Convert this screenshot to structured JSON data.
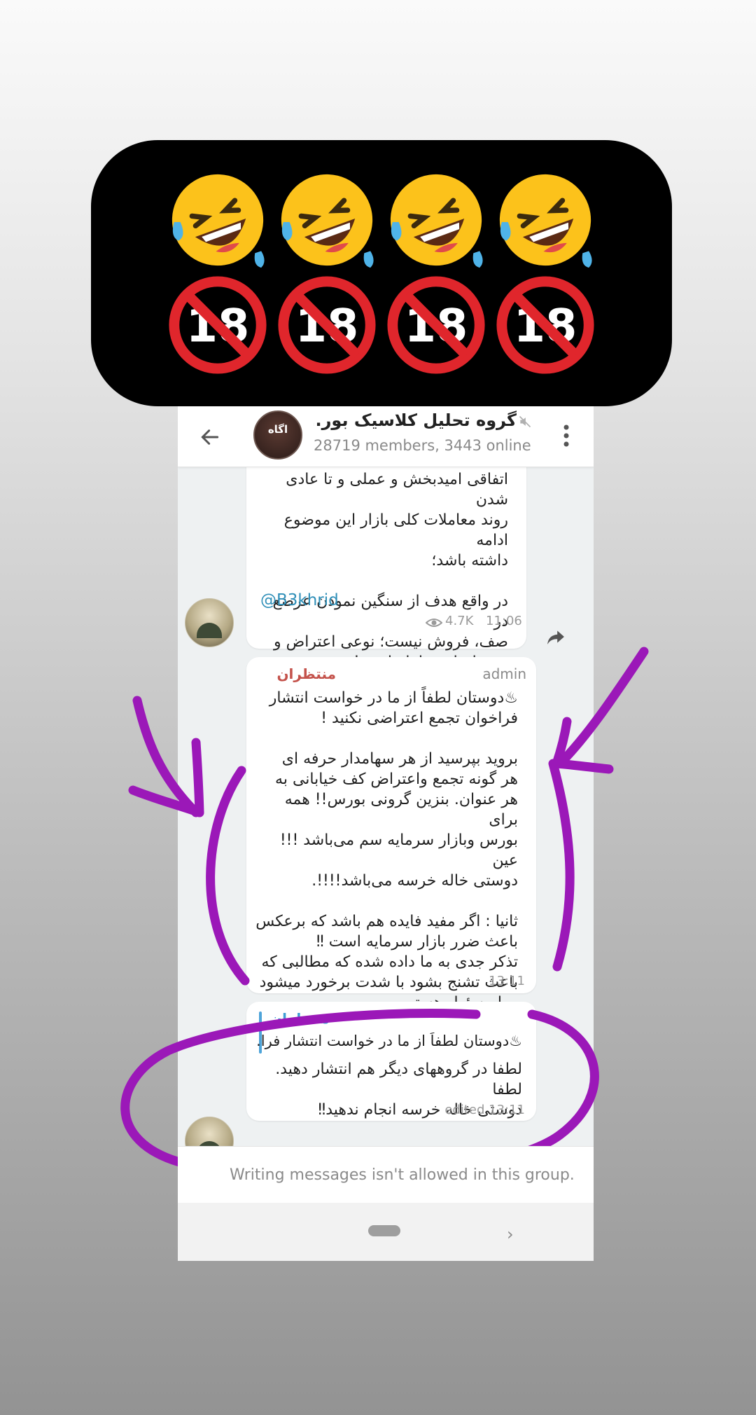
{
  "sticker": {
    "top_row": [
      "rolling-on-floor-laughing-emoji",
      "rolling-on-floor-laughing-emoji",
      "rolling-on-floor-laughing-emoji",
      "rolling-on-floor-laughing-emoji"
    ],
    "bottom_row_label": "18",
    "bottom_row": [
      "no-one-under-eighteen-emoji",
      "no-one-under-eighteen-emoji",
      "no-one-under-eighteen-emoji",
      "no-one-under-eighteen-emoji"
    ]
  },
  "header": {
    "title": "گروه تحلیل کلاسیک بور...",
    "subtitle": "28719 members, 3443 online",
    "avatar_text": "اگاه"
  },
  "messages": [
    {
      "text": "اتفاقی امیدبخش و عملی و تا عادی شدن\nروند معاملات کلی بازار این موضوع ادامه\nداشته باشد؛\n\nدر واقع هدف از سنگین نمودن عرضع در\nصف، فروش نیست؛ نوعی اعتراض و\nعدم انجام معامله است!",
      "mention": "@B3khrid",
      "views": "4.7K",
      "time": "11:06"
    },
    {
      "sender": "منتظران",
      "role": "admin",
      "text": "♨دوستان لطفاً از ما  در خواست انتشار\nفراخوان تجمع اعتراضی  نکنید !\n\n برويد بپرسید از هر سهامدار حرفه ای\nهر گونه تجمع  واعتراض کف خیابانی به\nهر عنوان. بنزين گرونی  بورس!! همه برای\nبورس وبازار سرمایه  سم می‌باشد !!! عین\nدوستی  خاله خرسه می‌باشد!!!!.\n\nثانیا : اگر مفید فایده هم باشد که برعکس\nباعث ضرر بازار سرمایه است ‼\nتذکر جدی به ما داده شده که مطالبی که\nباعث تشنج بشود با شدت برخورد میشود\nوما مسئول هستیم.",
      "time": "13:11"
    },
    {
      "reply_name": "منتظران",
      "reply_text": "♨دوستان لطفاً از ما  در خواست انتشار فرا...",
      "text": "لطفا در گروههای دیگر هم انتشار دهید. لطفا\nدوستی خاله خرسه انجام ندهید‼",
      "time": "edited 13:11"
    }
  ],
  "input_bar": {
    "text": "Writing messages isn't allowed in this group."
  },
  "colors": {
    "scribble": "#9b18b8",
    "sender": "#c4524b",
    "link": "#2f8fb8",
    "reply": "#3f9ed4"
  }
}
